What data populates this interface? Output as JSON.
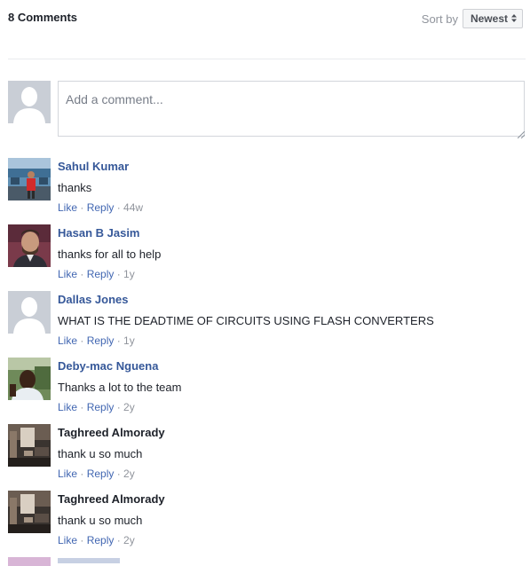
{
  "header": {
    "comment_count": "8 Comments",
    "sort_label": "Sort by",
    "sort_value": "Newest",
    "sort_caret": "⇕"
  },
  "composer": {
    "placeholder": "Add a comment..."
  },
  "actions": {
    "like": "Like",
    "reply": "Reply",
    "sep": " · "
  },
  "comments": [
    {
      "author": "Sahul Kumar",
      "text": "thanks",
      "time": "44w",
      "avatar": "photo-person-blue-bg"
    },
    {
      "author": "Hasan B Jasim",
      "text": "thanks for all to help",
      "time": "1y",
      "avatar": "photo-man-beard"
    },
    {
      "author": "Dallas Jones",
      "text": "WHAT IS THE DEADTIME OF CIRCUITS USING FLASH CONVERTERS",
      "time": "1y",
      "avatar": "default-silhouette"
    },
    {
      "author": "Deby-mac Nguena",
      "text": "Thanks a lot to the team",
      "time": "2y",
      "avatar": "photo-selfie-outdoor"
    },
    {
      "author": "Taghreed Almorady",
      "text": "thank u so much",
      "time": "2y",
      "avatar": "photo-room-interior"
    },
    {
      "author": "Taghreed Almorady",
      "text": "thank u so much",
      "time": "2y",
      "avatar": "photo-room-interior"
    }
  ],
  "colors": {
    "link": "#365899",
    "action_link": "#4267b2",
    "muted": "#90949c",
    "text": "#1d2129"
  }
}
